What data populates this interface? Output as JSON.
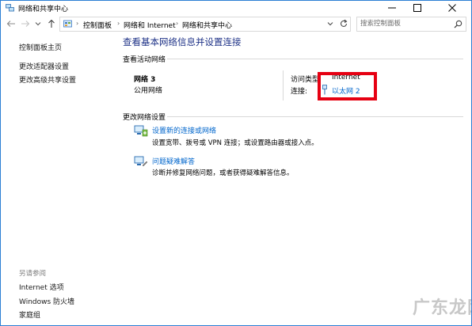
{
  "window": {
    "title": "网络和共享中心",
    "controls": {
      "minimize": "minimize-icon",
      "maximize": "maximize-icon",
      "close": "close-icon"
    }
  },
  "nav": {
    "breadcrumb": [
      "控制面板",
      "网络和 Internet",
      "网络和共享中心"
    ],
    "search_placeholder": "搜索控制面板"
  },
  "sidebar": {
    "links": [
      "控制面板主页",
      "更改适配器设置",
      "更改高级共享设置"
    ],
    "see_also_title": "另请参阅",
    "see_also": [
      "Internet 选项",
      "Windows 防火墙",
      "家庭组"
    ]
  },
  "main": {
    "title": "查看基本网络信息并设置连接",
    "active_networks": {
      "heading": "查看活动网络",
      "network_name": "网络  3",
      "network_type": "公用网络",
      "access_type_label": "访问类型:",
      "access_type_value": "Internet",
      "connections_label": "连接:",
      "connection": "以太网 2"
    },
    "change_settings": {
      "heading": "更改网络设置",
      "tasks": [
        {
          "title": "设置新的连接或网络",
          "desc": "设置宽带、拨号或 VPN 连接；或设置路由器或接入点。"
        },
        {
          "title": "问题疑难解答",
          "desc": "诊断并修复网络问题，或者获得疑难解答信息。"
        }
      ]
    }
  },
  "watermark": "广东龙网",
  "colors": {
    "title_blue": "#1e3287",
    "link_blue": "#0066cc",
    "highlight_red": "#e60012",
    "border_blue": "#2b7fd4"
  }
}
